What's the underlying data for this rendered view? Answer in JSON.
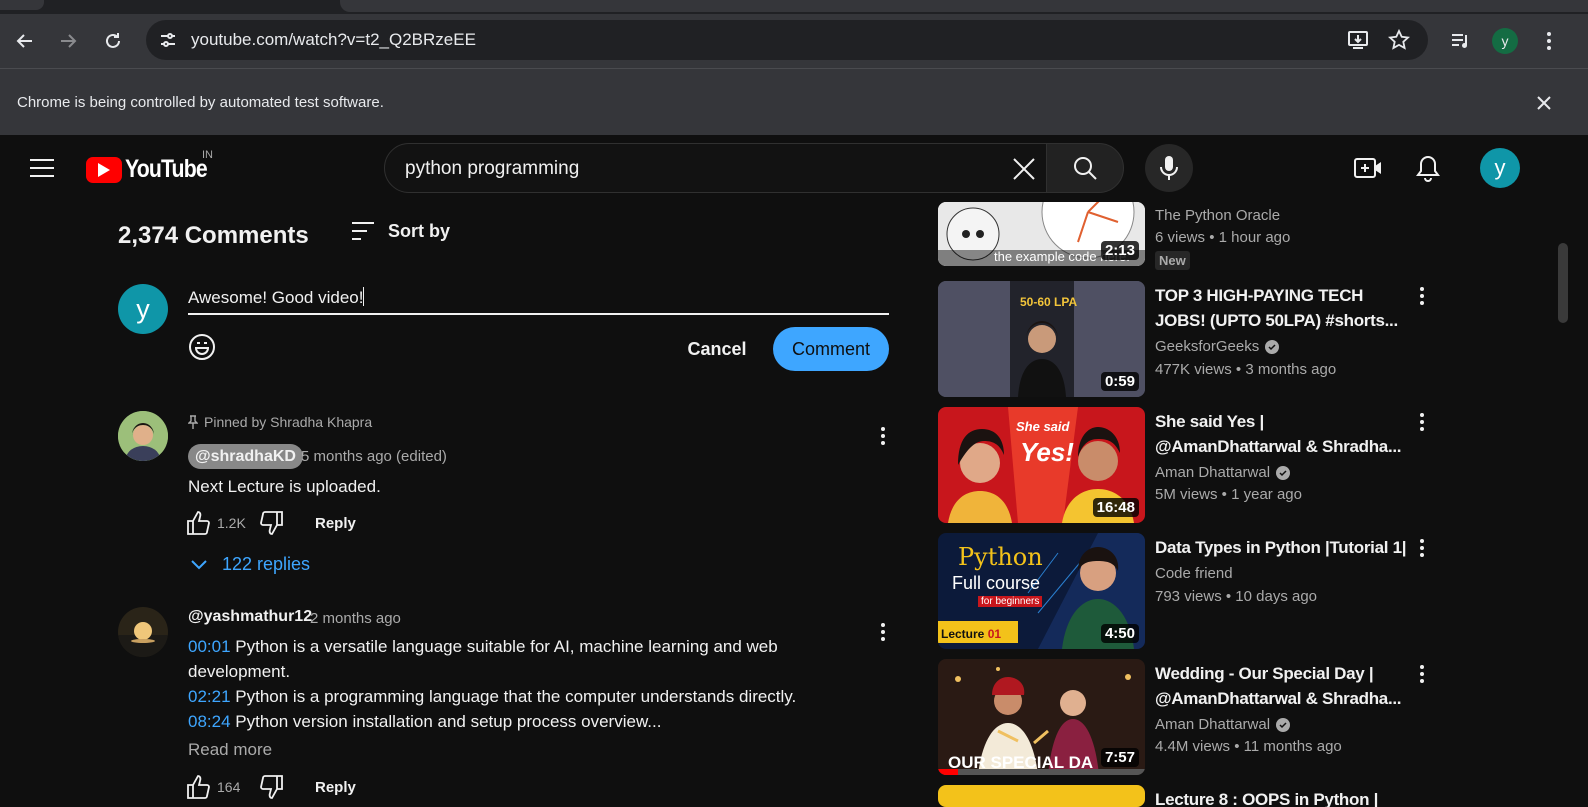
{
  "browser": {
    "url": "youtube.com/watch?v=t2_Q2BRzeEE",
    "profile_initial": "y",
    "infobar_message": "Chrome is being controlled by automated test software."
  },
  "masthead": {
    "logo_text": "YouTube",
    "region": "IN",
    "search_query": "python programming",
    "avatar_initial": "y"
  },
  "comments": {
    "count_label": "2,374 Comments",
    "sort_label": "Sort by",
    "composer": {
      "avatar_initial": "y",
      "draft": "Awesome! Good video!",
      "cancel_label": "Cancel",
      "submit_label": "Comment"
    },
    "items": [
      {
        "pinned_label": "Pinned by Shradha Khapra",
        "author": "@shradhaKD",
        "time": "5 months ago (edited)",
        "text": "Next Lecture is uploaded.",
        "likes": "1.2K",
        "reply_label": "Reply",
        "replies_label": "122 replies"
      },
      {
        "author": "@yashmathur12",
        "time": "2 months ago",
        "lines": [
          {
            "ts": "00:01",
            "text": " Python is a versatile language suitable for AI, machine learning and web"
          },
          {
            "ts": "",
            "text": "development."
          },
          {
            "ts": "02:21",
            "text": " Python is a programming language that the computer understands directly."
          },
          {
            "ts": "08:24",
            "text": " Python version installation and setup process overview..."
          }
        ],
        "read_more": "Read more",
        "likes": "164",
        "reply_label": "Reply"
      }
    ]
  },
  "sidebar": {
    "videos": [
      {
        "title": "",
        "channel": "The Python Oracle",
        "views": "6 views",
        "age": "1 hour ago",
        "badge": "New",
        "duration": "2:13",
        "thumb_caption": "the example code here."
      },
      {
        "title_lines": [
          "TOP 3 HIGH-PAYING TECH",
          "JOBS! (UPTO 50LPA) #shorts..."
        ],
        "channel": "GeeksforGeeks",
        "views": "477K views",
        "age": "3 months ago",
        "duration": "0:59",
        "thumb_caption": "50-60 LPA"
      },
      {
        "title_lines": [
          "She said Yes |",
          "@AmanDhattarwal & Shradha..."
        ],
        "channel": "Aman Dhattarwal",
        "views": "5M views",
        "age": "1 year ago",
        "duration": "16:48",
        "thumb_caption_1": "She said",
        "thumb_caption_2": "Yes!"
      },
      {
        "title_lines": [
          "Data Types in Python |Tutorial 1|"
        ],
        "channel": "Code friend",
        "views": "793 views",
        "age": "10 days ago",
        "duration": "4:50",
        "thumb_caption_1": "Python",
        "thumb_caption_2": "Full course",
        "thumb_caption_3": "for beginners",
        "thumb_caption_4": "Lecture",
        "thumb_caption_5": "01"
      },
      {
        "title_lines": [
          "Wedding - Our Special Day |",
          "@AmanDhattarwal & Shradha..."
        ],
        "channel": "Aman Dhattarwal",
        "views": "4.4M views",
        "age": "11 months ago",
        "duration": "7:57",
        "thumb_caption": "OUR SPECIAL DA"
      },
      {
        "title_lines": [
          "Lecture 8 : OOPS in Python |"
        ]
      }
    ]
  },
  "colors": {
    "background": "#0f0f0f",
    "link_blue": "#3ea6ff",
    "avatar_teal": "#0f96a8",
    "youtube_red": "#ff0000"
  }
}
